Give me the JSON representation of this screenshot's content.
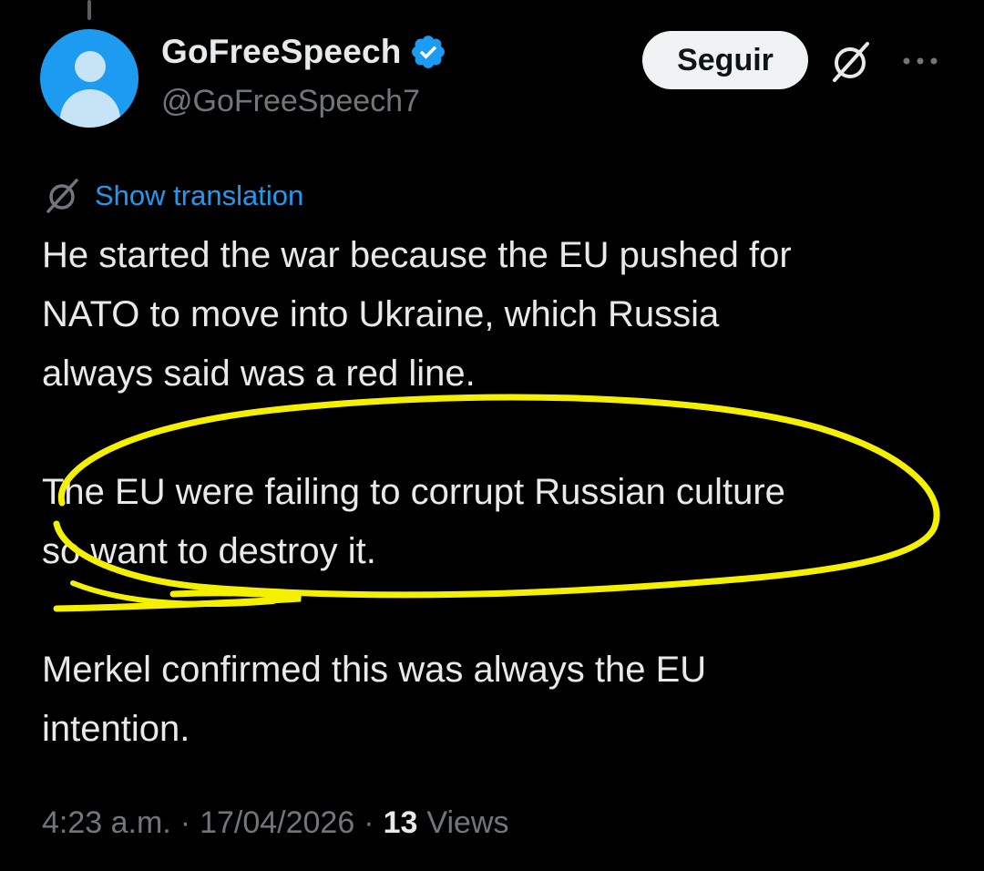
{
  "author": {
    "display_name": "GoFreeSpeech",
    "handle": "@GoFreeSpeech7",
    "verified": true
  },
  "actions": {
    "follow_label": "Seguir",
    "grok_icon": "grok-slash-icon",
    "more_icon": "more-dots-icon"
  },
  "translation": {
    "icon": "grok-slash-icon",
    "link_label": "Show translation"
  },
  "tweet": {
    "lines_p1": [
      "He started the war because  the EU pushed for",
      "NATO to move into Ukraine, which Russia",
      "always said was a red line."
    ],
    "lines_p2": [
      "The EU were failing to corrupt Russian culture",
      "so want to destroy it."
    ],
    "lines_p3": [
      "Merkel confirmed this was always the EU",
      "intention."
    ]
  },
  "meta": {
    "time": "4:23 a.m.",
    "date": "17/04/2026",
    "separator": "·",
    "views_count": "13",
    "views_label": "Views"
  },
  "colors": {
    "background": "#000000",
    "accent_blue": "#1d9bf0",
    "annotation_yellow": "#f5f000",
    "muted_gray": "#71767b"
  }
}
